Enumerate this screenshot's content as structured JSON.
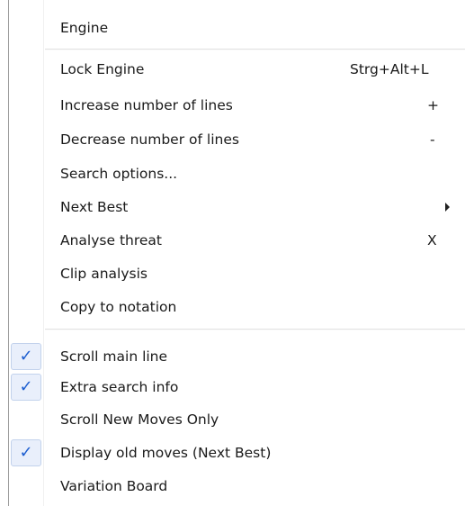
{
  "menu": {
    "header": "Engine",
    "items": [
      {
        "label": "Lock Engine",
        "shortcut": "Strg+Alt+L"
      },
      {
        "label": "Increase number of lines",
        "shortcut": "+"
      },
      {
        "label": "Decrease number of lines",
        "shortcut": "-"
      },
      {
        "label": "Search options..."
      },
      {
        "label": "Next Best",
        "submenu": true
      },
      {
        "label": "Analyse threat",
        "shortcut": "X"
      },
      {
        "label": "Clip analysis"
      },
      {
        "label": "Copy to notation"
      }
    ],
    "toggles": [
      {
        "label": "Scroll main line",
        "checked": true
      },
      {
        "label": "Extra search info",
        "checked": true
      },
      {
        "label": "Scroll New Moves Only",
        "checked": false
      },
      {
        "label": "Display old moves (Next Best)",
        "checked": true
      },
      {
        "label": "Variation Board",
        "checked": false
      }
    ],
    "check_glyph": "✓",
    "icons": {
      "check": "checkmark-icon",
      "submenu": "submenu-arrow-icon"
    },
    "colors": {
      "check": "#1e5fd0",
      "check_bg": "#e9effb",
      "separator": "#e2e2e2"
    }
  }
}
